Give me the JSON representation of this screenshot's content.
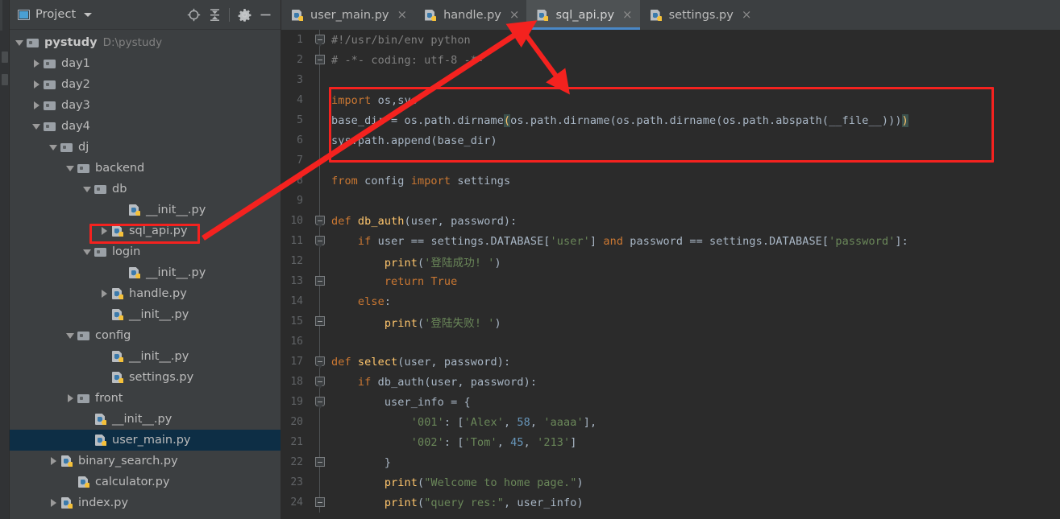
{
  "sidebar": {
    "title": "Project",
    "title_icon": "project-window-icon",
    "caret_icon": "chevron-down-icon",
    "toolbar": [
      {
        "name": "locate-icon",
        "label": "Select Opened File"
      },
      {
        "name": "collapse-all-icon",
        "label": "Collapse All"
      },
      {
        "name": "gear-icon",
        "label": "Settings"
      },
      {
        "name": "minimize-icon",
        "label": "Hide"
      }
    ],
    "tree": [
      {
        "label": "pystudy",
        "hint": "D:\\pystudy",
        "indent": 0,
        "arrow": "down",
        "icon": "folder",
        "root": true,
        "selected": false
      },
      {
        "label": "day1",
        "hint": "",
        "indent": 1,
        "arrow": "right",
        "icon": "folder",
        "root": false,
        "selected": false
      },
      {
        "label": "day2",
        "hint": "",
        "indent": 1,
        "arrow": "right",
        "icon": "folder",
        "root": false,
        "selected": false
      },
      {
        "label": "day3",
        "hint": "",
        "indent": 1,
        "arrow": "right",
        "icon": "folder",
        "root": false,
        "selected": false
      },
      {
        "label": "day4",
        "hint": "",
        "indent": 1,
        "arrow": "down",
        "icon": "folder",
        "root": false,
        "selected": false
      },
      {
        "label": "dj",
        "hint": "",
        "indent": 2,
        "arrow": "down",
        "icon": "folder",
        "root": false,
        "selected": false
      },
      {
        "label": "backend",
        "hint": "",
        "indent": 3,
        "arrow": "down",
        "icon": "folder",
        "root": false,
        "selected": false
      },
      {
        "label": "db",
        "hint": "",
        "indent": 4,
        "arrow": "down",
        "icon": "folder",
        "root": false,
        "selected": false
      },
      {
        "label": "__init__.py",
        "hint": "",
        "indent": 6,
        "arrow": "none",
        "icon": "python",
        "root": false,
        "selected": false
      },
      {
        "label": "sql_api.py",
        "hint": "",
        "indent": 5,
        "arrow": "right",
        "icon": "python",
        "root": false,
        "selected": false
      },
      {
        "label": "login",
        "hint": "",
        "indent": 4,
        "arrow": "down",
        "icon": "folder",
        "root": false,
        "selected": false
      },
      {
        "label": "__init__.py",
        "hint": "",
        "indent": 6,
        "arrow": "none",
        "icon": "python",
        "root": false,
        "selected": false
      },
      {
        "label": "handle.py",
        "hint": "",
        "indent": 5,
        "arrow": "right",
        "icon": "python",
        "root": false,
        "selected": false
      },
      {
        "label": "__init__.py",
        "hint": "",
        "indent": 5,
        "arrow": "none",
        "icon": "python",
        "root": false,
        "selected": false
      },
      {
        "label": "config",
        "hint": "",
        "indent": 3,
        "arrow": "down",
        "icon": "folder",
        "root": false,
        "selected": false
      },
      {
        "label": "__init__.py",
        "hint": "",
        "indent": 5,
        "arrow": "none",
        "icon": "python",
        "root": false,
        "selected": false
      },
      {
        "label": "settings.py",
        "hint": "",
        "indent": 5,
        "arrow": "none",
        "icon": "python",
        "root": false,
        "selected": false
      },
      {
        "label": "front",
        "hint": "",
        "indent": 3,
        "arrow": "right",
        "icon": "folder",
        "root": false,
        "selected": false
      },
      {
        "label": "__init__.py",
        "hint": "",
        "indent": 4,
        "arrow": "none",
        "icon": "python",
        "root": false,
        "selected": false
      },
      {
        "label": "user_main.py",
        "hint": "",
        "indent": 4,
        "arrow": "none",
        "icon": "python",
        "root": false,
        "selected": true
      },
      {
        "label": "binary_search.py",
        "hint": "",
        "indent": 2,
        "arrow": "right",
        "icon": "python",
        "root": false,
        "selected": false
      },
      {
        "label": "calculator.py",
        "hint": "",
        "indent": 3,
        "arrow": "none",
        "icon": "python",
        "root": false,
        "selected": false
      },
      {
        "label": "index.py",
        "hint": "",
        "indent": 2,
        "arrow": "right",
        "icon": "python",
        "root": false,
        "selected": false
      }
    ]
  },
  "tabs": [
    {
      "label": "user_main.py",
      "active": false,
      "icon": "python",
      "close_icon": "close-icon"
    },
    {
      "label": "handle.py",
      "active": false,
      "icon": "python",
      "close_icon": "close-icon"
    },
    {
      "label": "sql_api.py",
      "active": true,
      "icon": "python",
      "close_icon": "close-icon"
    },
    {
      "label": "settings.py",
      "active": false,
      "icon": "python",
      "close_icon": "close-icon"
    }
  ],
  "editor": {
    "lines": [
      {
        "n": "1",
        "fold": "open-top",
        "html": "<span class=\"cmt\">#!/usr/bin/env python</span>"
      },
      {
        "n": "2",
        "fold": "close-btm",
        "html": "<span class=\"cmt\"># -*- coding: utf-8 -*-</span>"
      },
      {
        "n": "3",
        "fold": "none",
        "html": ""
      },
      {
        "n": "4",
        "fold": "none",
        "html": "<span class=\"kw\">import</span><span class=\"plain\"> os,sys</span>"
      },
      {
        "n": "5",
        "fold": "none",
        "html": "<span class=\"plain\">base_dir = os.path.dirname</span><span class=\"paren-hl\">(</span><span class=\"plain\">os.path.dirname(os.path.dirname(os.path.abspath(__file__)))</span><span class=\"paren-hl\">)</span>"
      },
      {
        "n": "6",
        "fold": "none",
        "html": "<span class=\"plain\">sys.path.append(base_dir)</span>"
      },
      {
        "n": "7",
        "fold": "none",
        "html": ""
      },
      {
        "n": "8",
        "fold": "none",
        "html": "<span class=\"kw\">from</span><span class=\"plain\"> config </span><span class=\"kw\">import</span><span class=\"plain\"> settings</span>"
      },
      {
        "n": "9",
        "fold": "none",
        "html": ""
      },
      {
        "n": "10",
        "fold": "open-top",
        "html": "<span class=\"kw\">def</span><span class=\"plain\"> </span><span class=\"fn\">db_auth</span><span class=\"plain\">(user, password):</span>"
      },
      {
        "n": "11",
        "fold": "open",
        "html": "<span class=\"plain\">    </span><span class=\"kw\">if</span><span class=\"plain\"> user == settings.DATABASE[</span><span class=\"str\">'user'</span><span class=\"plain\">] </span><span class=\"kw\">and</span><span class=\"plain\"> password == settings.DATABASE[</span><span class=\"str\">'password'</span><span class=\"plain\">]:</span>"
      },
      {
        "n": "12",
        "fold": "none",
        "html": "<span class=\"plain\">        </span><span class=\"fn\">print</span><span class=\"plain\">(</span><span class=\"str\">'登陆成功! '</span><span class=\"plain\">)</span>"
      },
      {
        "n": "13",
        "fold": "close",
        "html": "<span class=\"plain\">        </span><span class=\"kw\">return True</span>"
      },
      {
        "n": "14",
        "fold": "none",
        "html": "<span class=\"plain\">    </span><span class=\"kw\">else</span><span class=\"plain\">:</span>"
      },
      {
        "n": "15",
        "fold": "close",
        "html": "<span class=\"plain\">        </span><span class=\"fn\">print</span><span class=\"plain\">(</span><span class=\"str\">'登陆失败! '</span><span class=\"plain\">)</span>"
      },
      {
        "n": "16",
        "fold": "none",
        "html": ""
      },
      {
        "n": "17",
        "fold": "open-top",
        "html": "<span class=\"kw\">def</span><span class=\"plain\"> </span><span class=\"fn\">select</span><span class=\"plain\">(user, password):</span>"
      },
      {
        "n": "18",
        "fold": "open",
        "html": "<span class=\"plain\">    </span><span class=\"kw\">if</span><span class=\"plain\"> db_auth(user, password):</span>"
      },
      {
        "n": "19",
        "fold": "open",
        "html": "<span class=\"plain\">        user_info = {</span>"
      },
      {
        "n": "20",
        "fold": "none",
        "html": "<span class=\"plain\">            </span><span class=\"str\">'001'</span><span class=\"plain\">: [</span><span class=\"str\">'Alex'</span><span class=\"plain\">, </span><span class=\"num\">58</span><span class=\"plain\">, </span><span class=\"str\">'aaaa'</span><span class=\"plain\">],</span>"
      },
      {
        "n": "21",
        "fold": "none",
        "html": "<span class=\"plain\">            </span><span class=\"str\">'002'</span><span class=\"plain\">: [</span><span class=\"str\">'Tom'</span><span class=\"plain\">, </span><span class=\"num\">45</span><span class=\"plain\">, </span><span class=\"str\">'213'</span><span class=\"plain\">]</span>"
      },
      {
        "n": "22",
        "fold": "close",
        "html": "<span class=\"plain\">        }</span>"
      },
      {
        "n": "23",
        "fold": "none",
        "html": "<span class=\"plain\">        </span><span class=\"fn\">print</span><span class=\"plain\">(</span><span class=\"str\">\"Welcome to home page.\"</span><span class=\"plain\">)</span>"
      },
      {
        "n": "24",
        "fold": "close",
        "html": "<span class=\"plain\">        </span><span class=\"fn\">print</span><span class=\"plain\">(</span><span class=\"str\">\"query res:\"</span><span class=\"plain\">, user_info)</span>"
      }
    ]
  },
  "annotations": {
    "color": "#f4221f",
    "tree_highlight_target": "sql_api.py",
    "code_highlight_lines": "4-6",
    "arrows": [
      {
        "name": "arrow-tree-to-tab",
        "from": "sql_api.py tree node",
        "to": "sql_api.py editor tab"
      },
      {
        "name": "arrow-tab-to-code",
        "from": "sql_api.py editor tab",
        "to": "highlighted code block"
      }
    ]
  }
}
